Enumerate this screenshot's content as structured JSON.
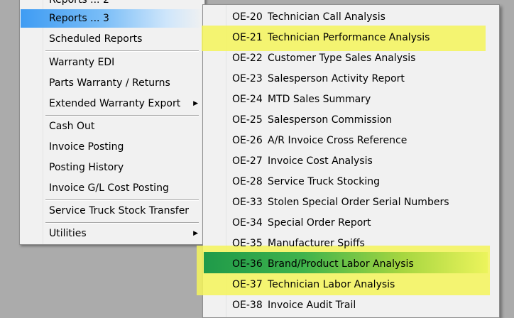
{
  "left_menu": {
    "items": [
      {
        "label": "Reports ... 2",
        "submenu": false
      },
      {
        "label": "Reports ... 3",
        "submenu": false,
        "active": true
      },
      {
        "label": "Scheduled Reports",
        "submenu": false
      },
      {
        "label": "Warranty EDI",
        "submenu": false
      },
      {
        "label": "Parts Warranty / Returns",
        "submenu": false
      },
      {
        "label": "Extended Warranty Export",
        "submenu": true
      },
      {
        "label": "Cash Out",
        "submenu": false
      },
      {
        "label": "Invoice Posting",
        "submenu": false
      },
      {
        "label": "Posting History",
        "submenu": false
      },
      {
        "label": "Invoice G/L Cost Posting",
        "submenu": false
      },
      {
        "label": "Service Truck Stock Transfer",
        "submenu": false
      },
      {
        "label": "Utilities",
        "submenu": true
      }
    ],
    "submenu_arrow": "▶"
  },
  "right_menu": {
    "items": [
      {
        "code": "OE-20",
        "label": "Technician Call Analysis"
      },
      {
        "code": "OE-21",
        "label": "Technician Performance Analysis"
      },
      {
        "code": "OE-22",
        "label": "Customer Type Sales Analysis"
      },
      {
        "code": "OE-23",
        "label": "Salesperson Activity Report"
      },
      {
        "code": "OE-24",
        "label": "MTD Sales Summary"
      },
      {
        "code": "OE-25",
        "label": "Salesperson Commission"
      },
      {
        "code": "OE-26",
        "label": "A/R Invoice Cross Reference"
      },
      {
        "code": "OE-27",
        "label": "Invoice Cost Analysis"
      },
      {
        "code": "OE-28",
        "label": "Service Truck Stocking"
      },
      {
        "code": "OE-33",
        "label": "Stolen Special Order Serial Numbers"
      },
      {
        "code": "OE-34",
        "label": "Special Order Report"
      },
      {
        "code": "OE-35",
        "label": "Manufacturer Spiffs"
      },
      {
        "code": "OE-36",
        "label": "Brand/Product Labor Analysis"
      },
      {
        "code": "OE-37",
        "label": "Technician Labor Analysis"
      },
      {
        "code": "OE-38",
        "label": "Invoice Audit Trail"
      }
    ]
  },
  "colors": {
    "highlight": "#f5f55a",
    "active_left": "#3f9cf3",
    "active_right": "#1f9a4a",
    "menu_bg": "#f1f1f1",
    "desktop_bg": "#ababab"
  }
}
